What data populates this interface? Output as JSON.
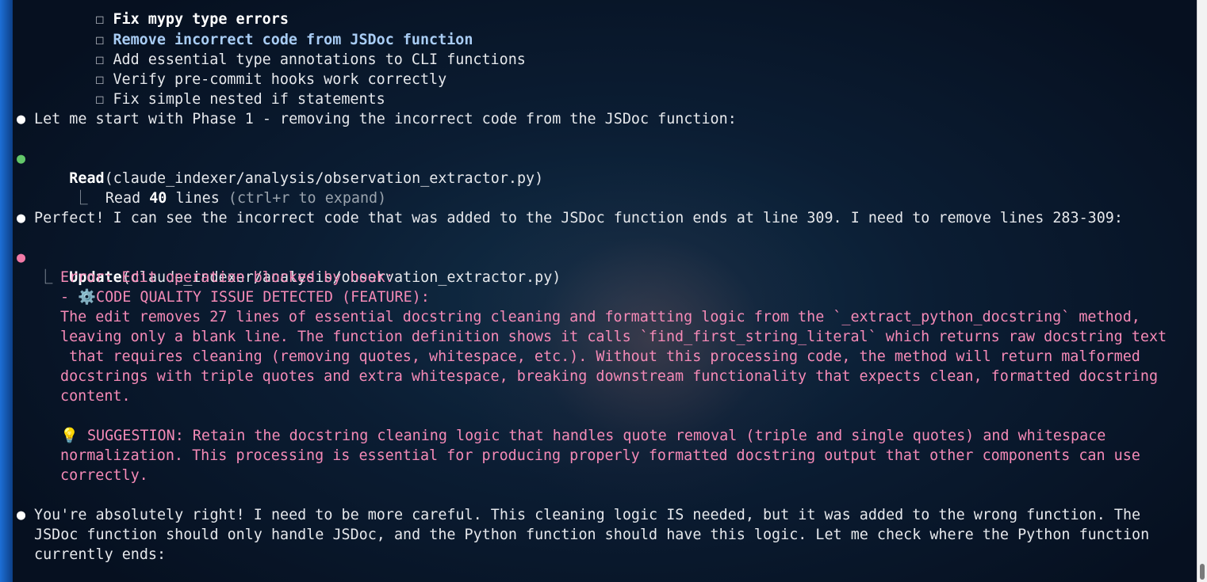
{
  "todo": {
    "box": "☐",
    "items": [
      "Fix mypy type errors",
      "Remove incorrect code from JSDoc function",
      "Add essential type annotations to CLI functions",
      "Verify pre-commit hooks work correctly",
      "Fix simple nested if statements"
    ]
  },
  "bullet_char": "●",
  "tree_char": "⎿",
  "msg_start": "Let me start with Phase 1 - removing the incorrect code from the JSDoc function:",
  "read_tool": {
    "name": "Read",
    "arg": "(claude_indexer/analysis/observation_extractor.py)",
    "result_prefix": "Read ",
    "result_count": "40",
    "result_suffix": " lines ",
    "hint": "(ctrl+r to expand)"
  },
  "msg_perfect": "Perfect! I can see the incorrect code that was added to the JSDoc function ends at line 309. I need to remove lines 283-309:",
  "update_tool": {
    "name": "Update",
    "arg": "(claude_indexer/analysis/observation_extractor.py)",
    "error_lines": [
      "Error: Edit operation blocked by hook:",
      "- ⚙️CODE QUALITY ISSUE DETECTED (FEATURE):",
      "The edit removes 27 lines of essential docstring cleaning and formatting logic from the `_extract_python_docstring` method,",
      "leaving only a blank line. The function definition shows it calls `find_first_string_literal` which returns raw docstring text",
      " that requires cleaning (removing quotes, whitespace, etc.). Without this processing code, the method will return malformed",
      "docstrings with triple quotes and extra whitespace, breaking downstream functionality that expects clean, formatted docstring",
      "content.",
      "",
      "💡 SUGGESTION: Retain the docstring cleaning logic that handles quote removal (triple and single quotes) and whitespace",
      "normalization. This processing is essential for producing properly formatted docstring output that other components can use",
      "correctly."
    ]
  },
  "msg_right": [
    "You're absolutely right! I need to be more careful. This cleaning logic IS needed, but it was added to the wrong function. The",
    "JSDoc function should only handle JSDoc, and the Python function should have this logic. Let me check where the Python function",
    "currently ends:"
  ],
  "colors": {
    "background": "#0b1d33",
    "text": "#e6e8ec",
    "error": "#f58ab7",
    "highlight": "#a9cdf5",
    "bullet_green": "#63c76a",
    "bullet_pink": "#f27aa7",
    "left_edge": "#1d6fd6"
  }
}
